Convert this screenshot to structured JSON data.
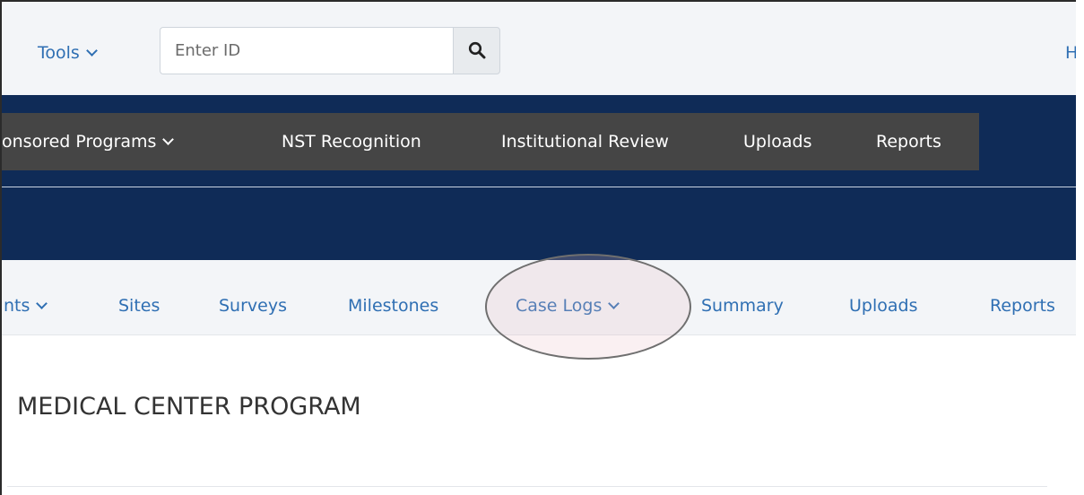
{
  "topbar": {
    "tools_label": "Tools",
    "id_input_placeholder": "Enter ID",
    "help_label": "H"
  },
  "primary_nav": {
    "items": [
      {
        "label": "onsored Programs",
        "has_dropdown": true
      },
      {
        "label": "NST Recognition"
      },
      {
        "label": "Institutional Review"
      },
      {
        "label": "Uploads"
      },
      {
        "label": "Reports"
      }
    ]
  },
  "secondary_nav": {
    "items": [
      {
        "label": "nts",
        "has_dropdown": true
      },
      {
        "label": "Sites"
      },
      {
        "label": "Surveys"
      },
      {
        "label": "Milestones"
      },
      {
        "label": "Case Logs",
        "has_dropdown": true,
        "highlighted": true
      },
      {
        "label": "Summary"
      },
      {
        "label": "Uploads"
      },
      {
        "label": "Reports"
      }
    ]
  },
  "page": {
    "title": "MEDICAL CENTER PROGRAM"
  },
  "colors": {
    "navy_band": "#0f2b57",
    "primary_nav_bg": "#454545",
    "link_blue": "#2f6fb3",
    "topbar_bg": "#f3f5f8"
  },
  "icons": {
    "search": "magnifier-icon",
    "dropdown": "chevron-down-icon"
  }
}
